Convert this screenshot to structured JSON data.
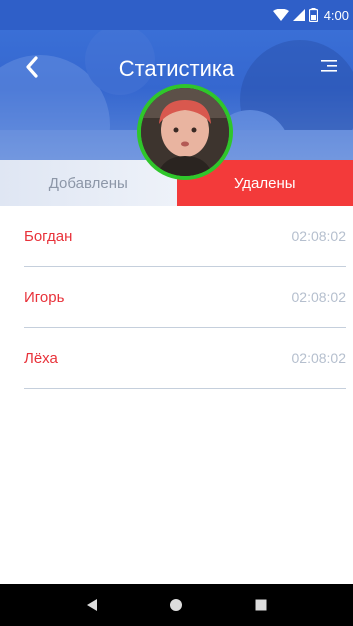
{
  "status_bar": {
    "time": "4:00",
    "icons": [
      "wifi-icon",
      "signal-icon",
      "battery-icon"
    ]
  },
  "header": {
    "title": "Статистика",
    "back_icon": "chevron-left-icon",
    "menu_icon": "menu-icon"
  },
  "tabs": [
    {
      "label": "Добавлены",
      "active": false
    },
    {
      "label": "Удалены",
      "active": true
    }
  ],
  "list": [
    {
      "name": "Богдан",
      "time": "02:08:02"
    },
    {
      "name": "Игорь",
      "time": "02:08:02"
    },
    {
      "name": "Лёха",
      "time": "02:08:02"
    }
  ],
  "colors": {
    "header_blue": "#3567cf",
    "accent_red": "#f33a3a",
    "avatar_ring": "#2fc62b",
    "name_red": "#e8323a",
    "time_gray": "#b5bfce"
  },
  "nav_bar": {
    "icons": [
      "back-triangle-icon",
      "home-circle-icon",
      "recents-square-icon"
    ]
  }
}
